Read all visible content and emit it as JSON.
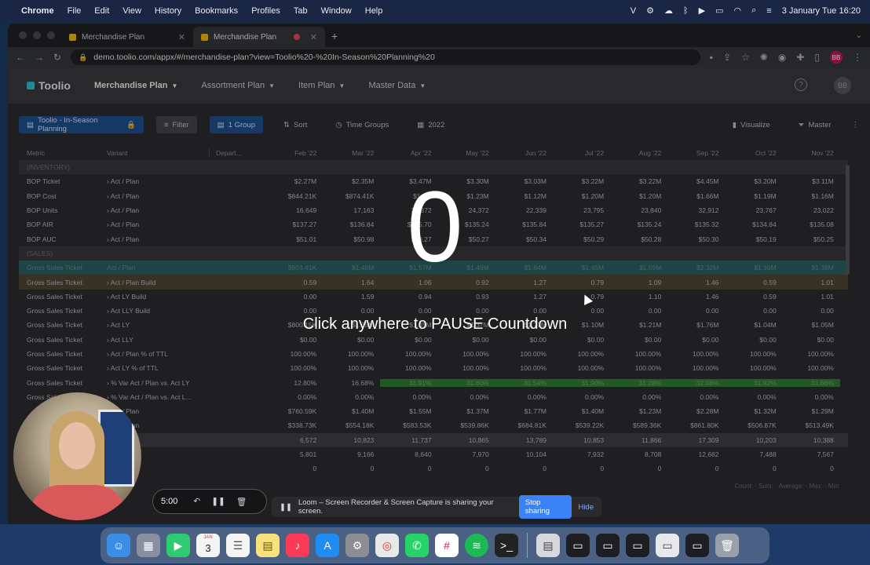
{
  "menubar": {
    "app": "Chrome",
    "items": [
      "File",
      "Edit",
      "View",
      "History",
      "Bookmarks",
      "Profiles",
      "Tab",
      "Window",
      "Help"
    ],
    "clock": "3 January Tue 16:20"
  },
  "browser": {
    "tabs": [
      {
        "title": "Merchandise Plan"
      },
      {
        "title": "Merchandise Plan"
      }
    ],
    "new_tab": "+",
    "url": "demo.toolio.com/appx/#/merchandise-plan?view=Toolio%20-%20In-Season%20Planning%20"
  },
  "app": {
    "logo": "Toolio",
    "nav": [
      "Merchandise Plan",
      "Assortment Plan",
      "Item Plan",
      "Master Data"
    ],
    "help": "?",
    "avatar": "BB"
  },
  "filterbar": {
    "view": "Toolio - In-Season Planning",
    "filter": "Filter",
    "group": "1 Group",
    "sort": "Sort",
    "time_groups": "Time Groups",
    "year": "2022",
    "visualize": "Visualize",
    "master": "Master"
  },
  "grid": {
    "headers": {
      "metric": "Metric",
      "variant": "Variant",
      "dept": "Depart...",
      "months": [
        "Feb '22",
        "Mar '22",
        "Apr '22",
        "May '22",
        "Jun '22",
        "Jul '22",
        "Aug '22",
        "Sep '22",
        "Oct '22",
        "Nov '22"
      ]
    },
    "rows": [
      {
        "metric": "(INVENTORY)",
        "variant": "",
        "vals": [
          "",
          "",
          "",
          "",
          "",
          "",
          "",
          "",
          "",
          ""
        ]
      },
      {
        "metric": "BOP Ticket",
        "variant": "› Act / Plan",
        "vals": [
          "$2.27M",
          "$2.35M",
          "$3.47M",
          "$3.30M",
          "$3.03M",
          "$3.22M",
          "$3.22M",
          "$4.45M",
          "$3.20M",
          "$3.11M"
        ]
      },
      {
        "metric": "BOP Cost",
        "variant": "› Act / Plan",
        "vals": [
          "$844.21K",
          "$874.41K",
          "$1.2M",
          "$1.23M",
          "$1.12M",
          "$1.20M",
          "$1.20M",
          "$1.66M",
          "$1.19M",
          "$1.16M"
        ]
      },
      {
        "metric": "BOP Units",
        "variant": "› Act / Plan",
        "vals": [
          "16,649",
          "17,163",
          "24,372",
          "24,372",
          "22,339",
          "23,795",
          "23,840",
          "32,912",
          "23,767",
          "23,022"
        ]
      },
      {
        "metric": "BOP AIR",
        "variant": "› Act / Plan",
        "vals": [
          "$137.27",
          "$136.84",
          "$135.70",
          "$135.24",
          "$135.84",
          "$135.27",
          "$135.24",
          "$135.32",
          "$134.84",
          "$135.08"
        ]
      },
      {
        "metric": "BOP AUC",
        "variant": "› Act / Plan",
        "vals": [
          "$51.01",
          "$50.98",
          "$50.27",
          "$50.27",
          "$50.34",
          "$50.29",
          "$50.28",
          "$50.30",
          "$50.19",
          "$50.25"
        ]
      },
      {
        "metric": "(SALES)",
        "variant": "",
        "vals": [
          "",
          "",
          "",
          "",
          "",
          "",
          "",
          "",
          "",
          ""
        ]
      },
      {
        "metric": "Gross Sales Ticket",
        "variant": "Act / Plan",
        "vals": [
          "$903.41K",
          "$1.48M",
          "$1.57M",
          "$1.45M",
          "$1.84M",
          "$1.45M",
          "$1.59M",
          "$2.32M",
          "$1.36M",
          "$1.38M"
        ]
      },
      {
        "metric": "Gross Sales Ticket",
        "variant": "› Act / Plan Build",
        "vals": [
          "0.59",
          "1.64",
          "1.06",
          "0.92",
          "1.27",
          "0.79",
          "1.09",
          "1.46",
          "0.59",
          "1.01"
        ]
      },
      {
        "metric": "Gross Sales Ticket",
        "variant": "› Act LY Build",
        "vals": [
          "0.00",
          "1.59",
          "0.94",
          "0.93",
          "1.27",
          "0.79",
          "1.10",
          "1.46",
          "0.59",
          "1.01"
        ]
      },
      {
        "metric": "Gross Sales Ticket",
        "variant": "› Act LLY Build",
        "vals": [
          "0.00",
          "0.00",
          "0.00",
          "0.00",
          "0.00",
          "0.00",
          "0.00",
          "0.00",
          "0.00",
          "0.00"
        ]
      },
      {
        "metric": "Gross Sales Ticket",
        "variant": "› Act LY",
        "vals": [
          "$800.15K",
          "$1.35M",
          "$1.45M",
          "$1.37M",
          "$1.77M",
          "$1.10M",
          "$1.21M",
          "$1.76M",
          "$1.04M",
          "$1.05M"
        ]
      },
      {
        "metric": "Gross Sales Ticket",
        "variant": "› Act LLY",
        "vals": [
          "$0.00",
          "$0.00",
          "$0.00",
          "$0.00",
          "$0.00",
          "$0.00",
          "$0.00",
          "$0.00",
          "$0.00",
          "$0.00"
        ]
      },
      {
        "metric": "Gross Sales Ticket",
        "variant": "› Act / Plan % of TTL",
        "vals": [
          "100.00%",
          "100.00%",
          "100.00%",
          "100.00%",
          "100.00%",
          "100.00%",
          "100.00%",
          "100.00%",
          "100.00%",
          "100.00%"
        ]
      },
      {
        "metric": "Gross Sales Ticket",
        "variant": "› Act LY % of TTL",
        "vals": [
          "100.00%",
          "100.00%",
          "100.00%",
          "100.00%",
          "100.00%",
          "100.00%",
          "100.00%",
          "100.00%",
          "100.00%",
          "100.00%"
        ]
      },
      {
        "metric": "Gross Sales Ticket",
        "variant": "› % Var Act / Plan vs. Act LY",
        "vals": [
          "12.80%",
          "16.68%",
          "31.91%",
          "31.60%",
          "31.54%",
          "31.90%",
          "31.28%",
          "32.08%",
          "31.92%",
          "31.66%"
        ]
      },
      {
        "metric": "Gross Sales Ticket",
        "variant": "› % Var Act / Plan vs. Act L...",
        "vals": [
          "0.00%",
          "0.00%",
          "0.00%",
          "0.00%",
          "0.00%",
          "0.00%",
          "0.00%",
          "0.00%",
          "0.00%",
          "0.00%"
        ]
      },
      {
        "metric": "",
        "variant": "› Act / Plan",
        "vals": [
          "$760.59K",
          "$1.40M",
          "$1.55M",
          "$1.37M",
          "$1.77M",
          "$1.40M",
          "$1.23M",
          "$2.28M",
          "$1.32M",
          "$1.29M"
        ]
      },
      {
        "metric": "",
        "variant": "› Act / Plan",
        "vals": [
          "$338.73K",
          "$554.18K",
          "$583.53K",
          "$539.86K",
          "$684.81K",
          "$539.22K",
          "$589.36K",
          "$861.80K",
          "$506.87K",
          "$513.49K"
        ]
      },
      {
        "metric": "",
        "variant": "",
        "vals": [
          "6,572",
          "10,823",
          "11,737",
          "10,865",
          "13,789",
          "10,853",
          "11,866",
          "17,309",
          "10,203",
          "10,388"
        ]
      },
      {
        "metric": "",
        "variant": "",
        "vals": [
          "5,801",
          "9,166",
          "8,640",
          "7,970",
          "10,104",
          "7,932",
          "8,708",
          "12,682",
          "7,488",
          "7,567"
        ]
      },
      {
        "metric": "",
        "variant": "",
        "vals": [
          "0",
          "0",
          "0",
          "0",
          "0",
          "0",
          "0",
          "0",
          "0",
          "0"
        ]
      }
    ],
    "footer": "Count: · Sum: · Average: · Max: · Min:"
  },
  "overlay": {
    "countdown": "0",
    "message": "Click anywhere to PAUSE Countdown"
  },
  "loom": {
    "time": "5:00",
    "banner": "Loom – Screen Recorder & Screen Capture is sharing your screen.",
    "stop": "Stop sharing",
    "hide": "Hide"
  },
  "dock": {
    "calendar_month": "JAN",
    "calendar_day": "3"
  }
}
